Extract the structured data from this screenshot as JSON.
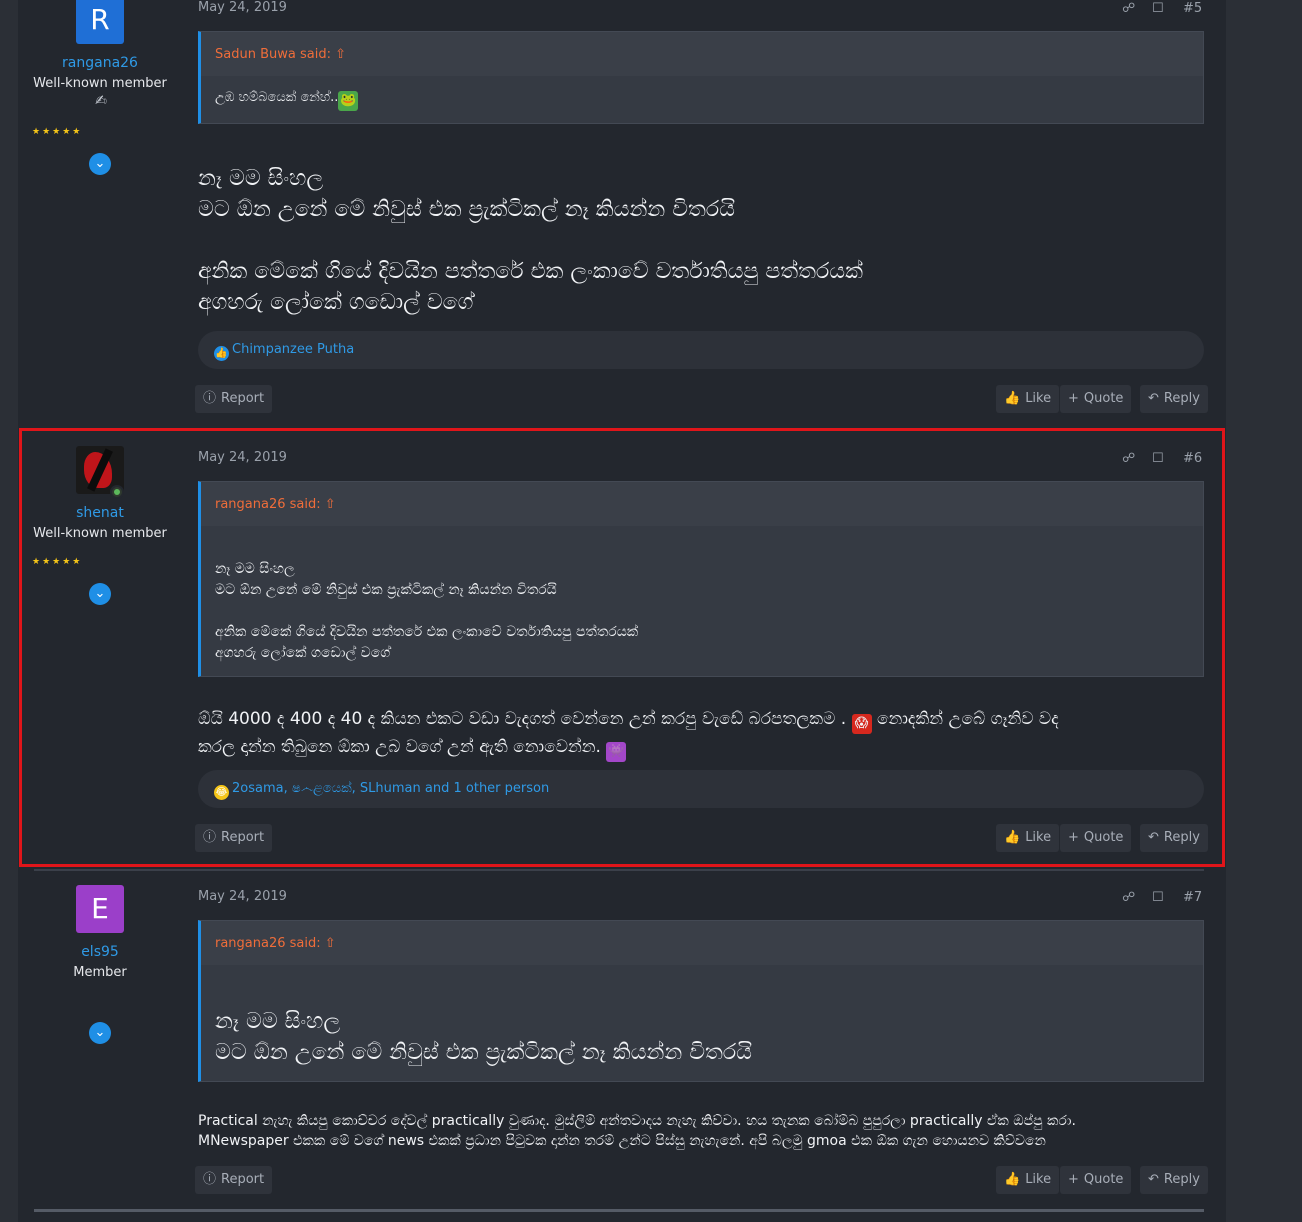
{
  "posts": [
    {
      "id": "post-5",
      "avatar_letter": "R",
      "avatar_color": "#1f6fd6",
      "username": "rangana26",
      "usertitle": "Well-known member",
      "stars": "★★★★★",
      "date": "May 24, 2019",
      "post_number": "#5",
      "quote": {
        "author": "Sadun Buwa said:",
        "lines": [
          "උඹ හම්බයෙක් නේහ්.."
        ]
      },
      "message": [
        "නෑ මම සිංහල",
        "මට ඕන උනේ මේ නිවුස් එක ප්‍රැක්ටිකල් නෑ කියන්න විතරයි",
        "",
        "අනික මේකේ ගියේ දිවයින පත්තරේ එක ලංකාවේ වර්තාතියපු පත්තරයක්",
        "අගහරු ලෝකේ ගඩොල් වගේ"
      ],
      "reactions": "Chimpanzee Putha"
    },
    {
      "id": "post-6",
      "username": "shenat",
      "usertitle": "Well-known member",
      "stars": "★★★★★",
      "date": "May 24, 2019",
      "post_number": "#6",
      "quote": {
        "author": "rangana26 said:",
        "lines": [
          "නෑ මම සිංහල",
          "මට ඕන උනේ මේ නිවුස් එක ප්‍රැක්ටිකල් නෑ කියන්න විතරයි",
          "",
          "අනික මේකේ ගියේ දිවයින පත්තරේ එක ලංකාවේ වර්තාතියපු පත්තරයක්",
          "අගහරු ලෝකේ ගඩොල් වගේ"
        ]
      },
      "message": [
        "ඕයි 4000 ද 400 ද 40 ද කියන එකට වඩා වැදගත් වෙන්නෙ උන් කරපු වැඩේ බරපතලකම .",
        "නොදකින් උබේ ගෑනිව වද",
        "කරල දාන්න තිබුනෙ ඕකා උබ වගේ උන් ඇති නොවෙන්න."
      ],
      "reactions": "2osama, ‌ෂ෴ළයෙක්, SLhuman and 1 other person"
    },
    {
      "id": "post-7",
      "avatar_letter": "E",
      "avatar_color": "#9b3fc9",
      "username": "els95",
      "usertitle": "Member",
      "date": "May 24, 2019",
      "post_number": "#7",
      "quote": {
        "author": "rangana26 said:",
        "lines": [
          "නෑ මම සිංහල",
          "මට ඕන උනේ මේ නිවුස් එක ප්‍රැක්ටිකල් නෑ කියන්න විතරයි"
        ]
      },
      "message": [
        "Practical නැහැ කියපු කොච්චර දේවල් practically වුණාද. මුස්ලිම් අන්තවාදය නැහැ කිව්වා. හය තැනක බෝම්බ පුපුරලා practically ඒක ඔප්පු කරා.",
        "MNewspaper එකක මේ වගේ news එකක් ප්‍රධාන පිටුවක දාන්න තරම් උන්ට පිස්සු නැහැනේ. අපි බලමු gmoa එක ඕක ගැන හොයනව කිව්වනෙ"
      ]
    }
  ],
  "actions": {
    "report": "Report",
    "like": "Like",
    "quote": "Quote",
    "reply": "Reply"
  },
  "colors": {
    "link": "#2f9ae6",
    "quote_author": "#ef6d3a",
    "highlight_border": "#e0151a"
  },
  "icons": [
    "share-icon",
    "bookmark-icon",
    "report-icon",
    "like-icon",
    "quote-plus-icon",
    "reply-icon",
    "expand-chevron-icon",
    "trophy-icon",
    "go-to-quote-icon"
  ]
}
